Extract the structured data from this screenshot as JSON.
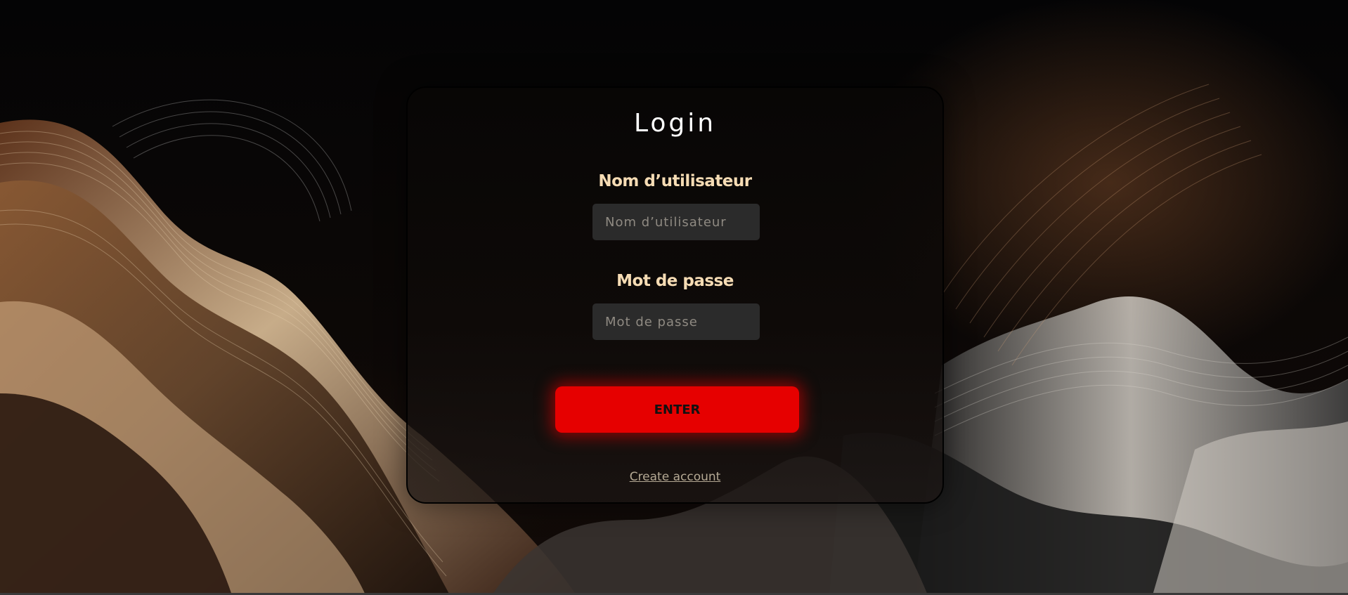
{
  "login": {
    "title": "Login",
    "username_label": "Nom d’utilisateur",
    "username_placeholder": "Nom d’utilisateur",
    "username_value": "",
    "password_label": "Mot de passe",
    "password_placeholder": "Mot de passe",
    "password_value": "",
    "enter_label": "ENTER",
    "create_account_label": "Create account"
  },
  "colors": {
    "label_color": "#f6dcb4",
    "button_color": "#e60000",
    "field_background": "#2b2b2b",
    "background_accent": "#8a5a34"
  }
}
